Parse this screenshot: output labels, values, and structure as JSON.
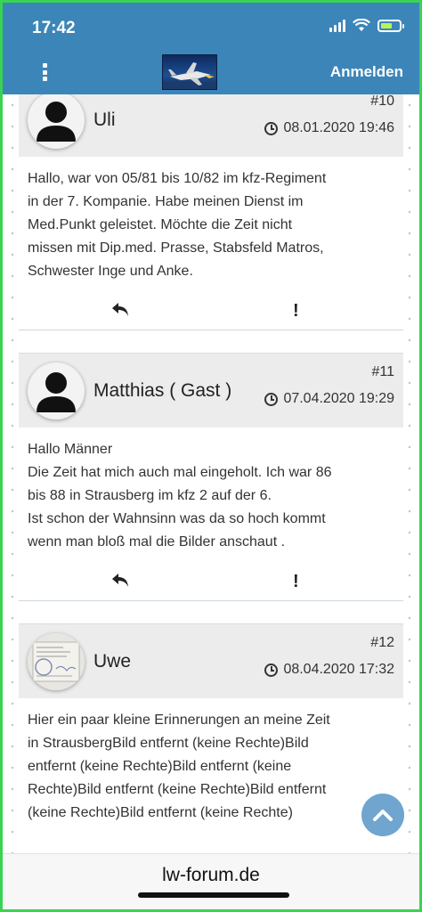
{
  "status": {
    "time": "17:42"
  },
  "header": {
    "login_label": "Anmelden",
    "logo_icon": "jet-logo-icon"
  },
  "posts": [
    {
      "author": "Uli",
      "number": "#10",
      "date": "08.01.2020 19:46",
      "lines": [
        "Hallo, war von 05/81 bis 10/82 im kfz-Regiment",
        "in der 7. Kompanie. Habe meinen Dienst im",
        "Med.Punkt geleistet. Möchte die Zeit nicht",
        "missen mit Dip.med. Prasse, Stabsfeld Matros,",
        "Schwester Inge und Anke."
      ]
    },
    {
      "author": "Matthias ( Gast )",
      "number": "#11",
      "date": "07.04.2020 19:29",
      "lines": [
        "Hallo Männer",
        "Die Zeit hat mich auch mal eingeholt. Ich war 86",
        "bis 88 in Strausberg im kfz 2 auf der 6.",
        "Ist schon der Wahnsinn was da so hoch kommt",
        "wenn man bloß mal die Bilder anschaut ."
      ]
    },
    {
      "author": "Uwe",
      "number": "#12",
      "date": "08.04.2020 17:32",
      "lines": [
        "Hier ein paar kleine Erinnerungen an meine Zeit",
        "in StrausbergBild entfernt (keine Rechte)Bild",
        "entfernt (keine Rechte)Bild entfernt (keine",
        "Rechte)Bild entfernt (keine Rechte)Bild entfernt",
        "(keine Rechte)Bild entfernt (keine Rechte)"
      ]
    }
  ],
  "footer": {
    "url": "lw-forum.de"
  },
  "colors": {
    "accent": "#3b85b9",
    "scroll_button": "#6fa5cf",
    "header_bg": "#ececec"
  }
}
